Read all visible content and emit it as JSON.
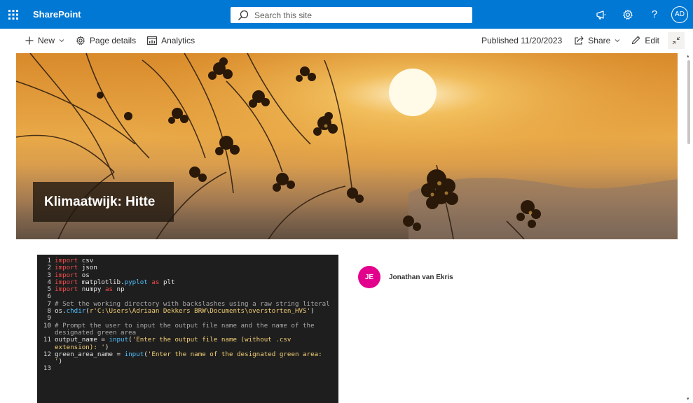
{
  "suitebar": {
    "app_name": "SharePoint",
    "search_placeholder": "Search this site",
    "user_initials": "AD",
    "accent": "#0078d4",
    "icons": [
      "waffle-icon",
      "megaphone-icon",
      "gear-icon",
      "help-icon"
    ]
  },
  "command_bar": {
    "new_label": "New",
    "page_details_label": "Page details",
    "analytics_label": "Analytics",
    "published_text": "Published 11/20/2023",
    "share_label": "Share",
    "edit_label": "Edit"
  },
  "hero": {
    "title": "Klimaatwijk: Hitte"
  },
  "code": {
    "lines": [
      {
        "n": "1",
        "parts": [
          [
            "kw",
            "import"
          ],
          [
            "id",
            " csv"
          ]
        ]
      },
      {
        "n": "2",
        "parts": [
          [
            "kw",
            "import"
          ],
          [
            "id",
            " json"
          ]
        ]
      },
      {
        "n": "3",
        "parts": [
          [
            "kw",
            "import"
          ],
          [
            "id",
            " os"
          ]
        ]
      },
      {
        "n": "4",
        "parts": [
          [
            "kw",
            "import"
          ],
          [
            "id",
            " matplotlib."
          ],
          [
            "fn",
            "pyplot"
          ],
          [
            "kw",
            " as"
          ],
          [
            "id",
            " plt"
          ]
        ]
      },
      {
        "n": "5",
        "parts": [
          [
            "kw",
            "import"
          ],
          [
            "id",
            " numpy"
          ],
          [
            "kw",
            " as"
          ],
          [
            "id",
            " np"
          ]
        ]
      },
      {
        "n": "6",
        "parts": []
      },
      {
        "n": "7",
        "parts": [
          [
            "cm",
            "# Set the working directory with backslashes using a raw string literal"
          ]
        ]
      },
      {
        "n": "8",
        "parts": [
          [
            "id",
            "os."
          ],
          [
            "fn",
            "chdir"
          ],
          [
            "id",
            "("
          ],
          [
            "str",
            "r'C:\\Users\\Adriaan Dekkers BRW\\Documents\\overstorten_HVS'"
          ],
          [
            "id",
            ")"
          ]
        ]
      },
      {
        "n": "9",
        "parts": []
      },
      {
        "n": "10",
        "parts": [
          [
            "cm",
            "# Prompt the user to input the output file name and the name of the designated green area"
          ]
        ]
      },
      {
        "n": "11",
        "parts": [
          [
            "id",
            "output_name = "
          ],
          [
            "fn",
            "input"
          ],
          [
            "id",
            "("
          ],
          [
            "str",
            "'Enter the output file name (without .csv extension): '"
          ],
          [
            "id",
            ")"
          ]
        ]
      },
      {
        "n": "12",
        "parts": [
          [
            "id",
            "green_area_name = "
          ],
          [
            "fn",
            "input"
          ],
          [
            "id",
            "("
          ],
          [
            "str",
            "'Enter the name of the designated green area: '"
          ],
          [
            "id",
            ")"
          ]
        ]
      },
      {
        "n": "13",
        "parts": []
      }
    ]
  },
  "author": {
    "initials": "JE",
    "name": "Jonathan van Ekris",
    "avatar_color": "#e3008c"
  }
}
